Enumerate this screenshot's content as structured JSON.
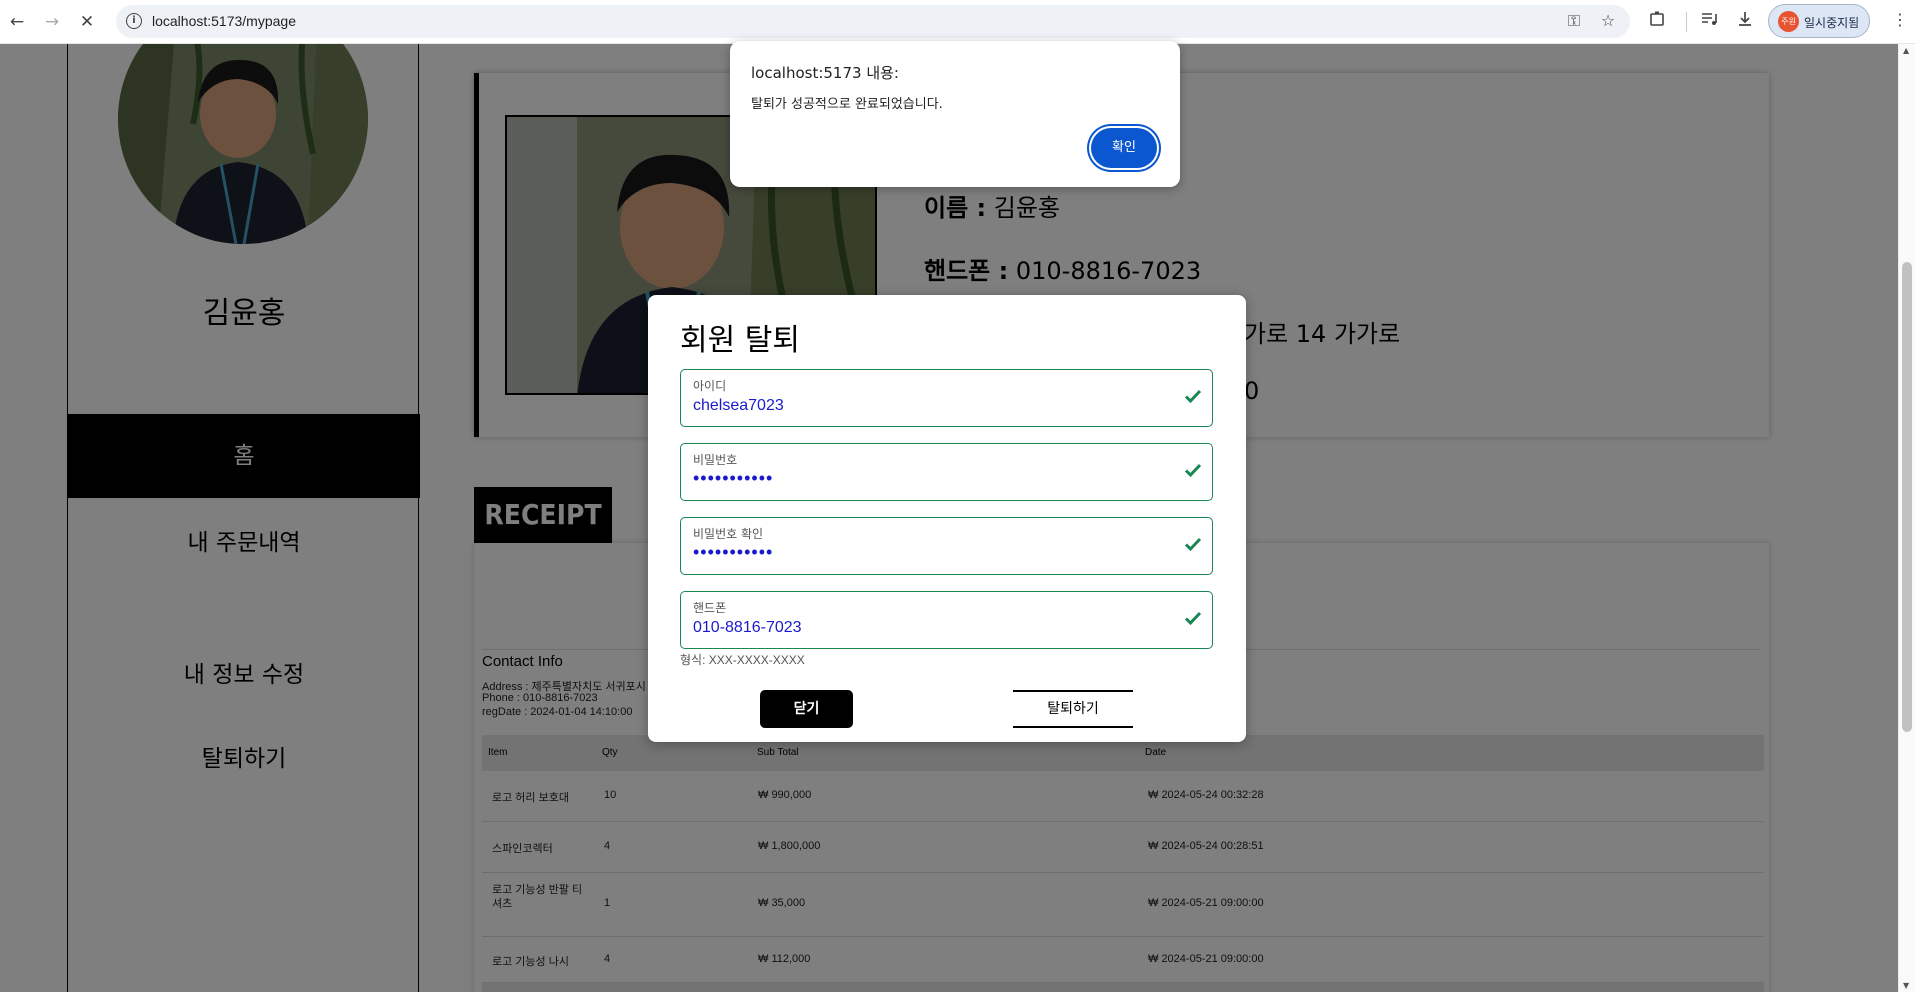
{
  "browser": {
    "url": "localhost:5173/mypage",
    "profile_name": "일시중지됨",
    "profile_initial": "주원"
  },
  "sidebar": {
    "user_name": "김윤홍",
    "menu": [
      {
        "label": "홈",
        "active": true
      },
      {
        "label": "내 주문내역",
        "active": false
      },
      {
        "label": "내 정보 수정",
        "active": false
      },
      {
        "label": "탈퇴하기",
        "active": false
      }
    ]
  },
  "profile_card": {
    "name_label": "이름 :",
    "name_value": "김윤홍",
    "phone_label": "핸드폰 :",
    "phone_value": "010-8816-7023",
    "address_tail": "가로 14 가가로",
    "partial_tail": "0"
  },
  "receipt": {
    "tab_label": "RECEIPT",
    "contact_title": "Contact Info",
    "address_line": "Address : 제주특별자치도 서귀포시 가",
    "phone_line": "Phone : 010-8816-7023",
    "regdate_line": "regDate : 2024-01-04 14:10:00",
    "columns": [
      "Item",
      "Qty",
      "Sub Total",
      "Date"
    ],
    "rows": [
      [
        "로고 허리 보호대",
        "10",
        "₩ 990,000",
        "₩ 2024-05-24 00:32:28"
      ],
      [
        "스파인코렉터",
        "4",
        "₩ 1,800,000",
        "₩ 2024-05-24 00:28:51"
      ],
      [
        "로고 기능성 반팔 티셔츠",
        "1",
        "₩ 35,000",
        "₩ 2024-05-21 09:00:00"
      ],
      [
        "로고 기능성 나시",
        "4",
        "₩ 112,000",
        "₩ 2024-05-21 09:00:00"
      ]
    ]
  },
  "modal": {
    "title": "회원 탈퇴",
    "fields": [
      {
        "label": "아이디",
        "value": "chelsea7023"
      },
      {
        "label": "비밀번호",
        "value": "•••••••••••"
      },
      {
        "label": "비밀번호 확인",
        "value": "•••••••••••"
      },
      {
        "label": "핸드폰",
        "value": "010-8816-7023"
      }
    ],
    "hint": "형식: XXX-XXXX-XXXX",
    "close_label": "닫기",
    "withdraw_label": "탈퇴하기",
    "valid_color": "#198754"
  },
  "alert": {
    "title": "localhost:5173 내용:",
    "message": "탈퇴가 성공적으로 완료되었습니다.",
    "ok_label": "확인"
  }
}
